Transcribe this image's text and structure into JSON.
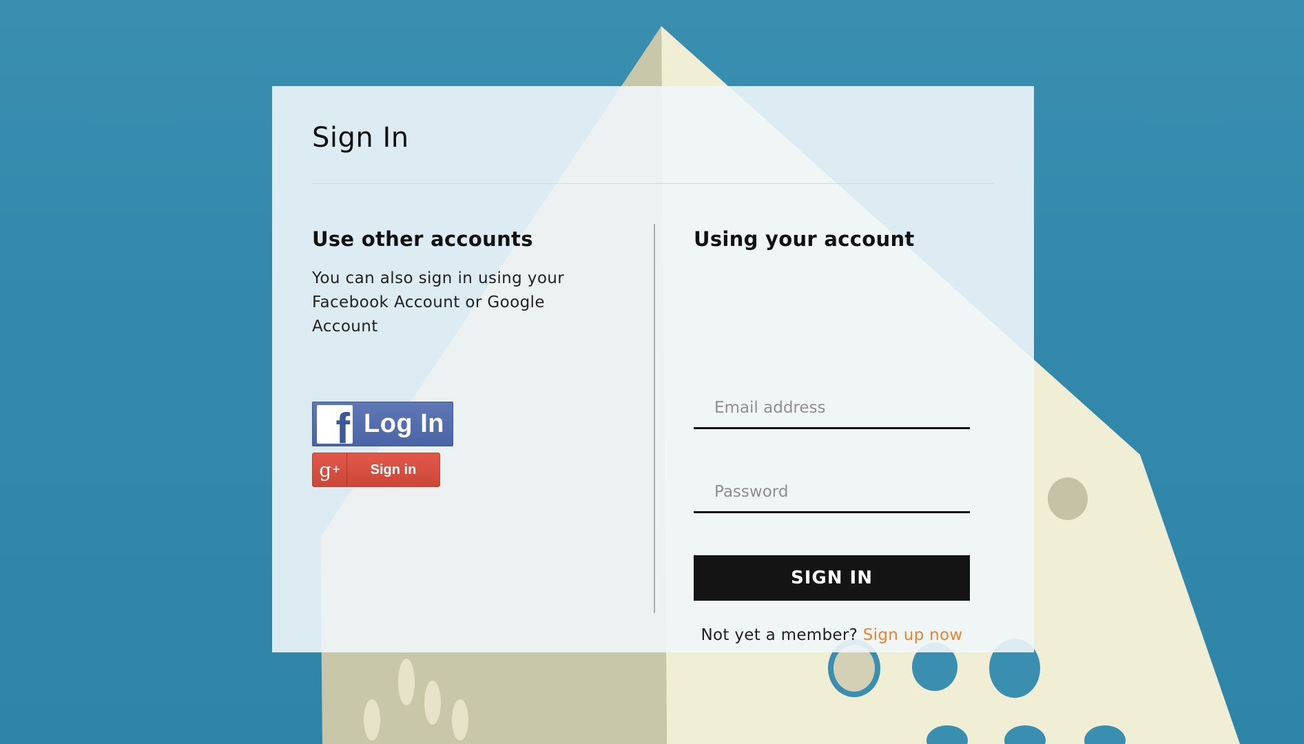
{
  "card": {
    "title": "Sign In"
  },
  "other_accounts": {
    "heading": "Use other accounts",
    "description": "You can also sign in using your Facebook Account or Google Account",
    "facebook_button_label": "Log In",
    "facebook_icon": "f",
    "google_button_label": "Sign in",
    "google_icon": "g"
  },
  "account": {
    "heading": "Using your account",
    "email_placeholder": "Email address",
    "password_placeholder": "Password",
    "submit_label": "SIGN IN",
    "signup_prompt": "Not yet a member?",
    "signup_link": "Sign up now"
  },
  "colors": {
    "background": "#3289ab",
    "accent": "#e8832e",
    "button": "#141414",
    "facebook": "#4a64a6",
    "google": "#dd4b39"
  }
}
